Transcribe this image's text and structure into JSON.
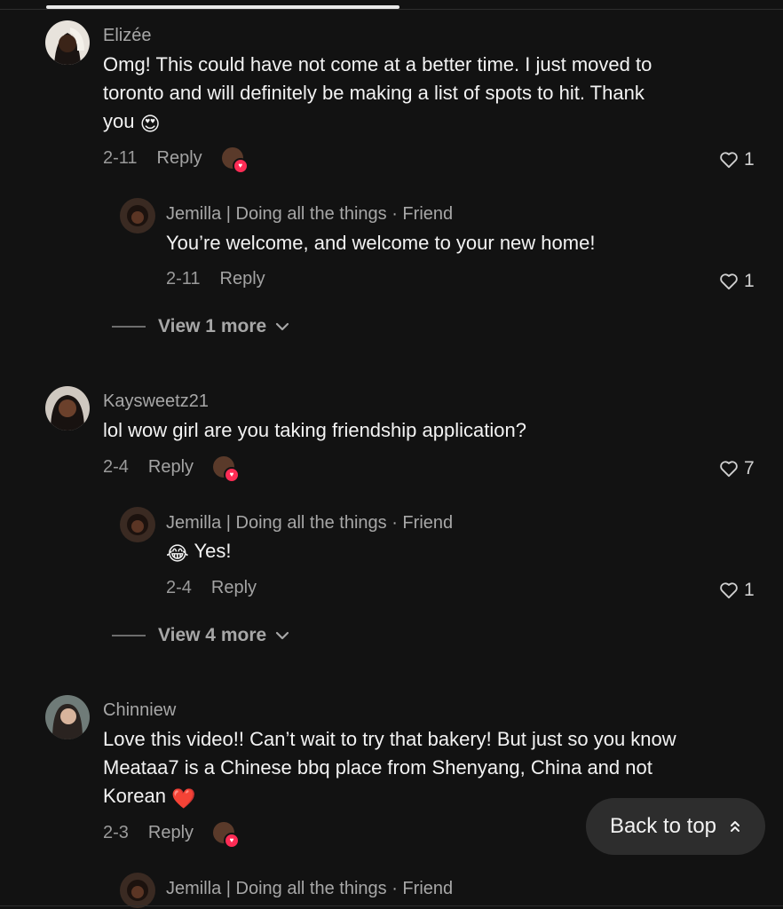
{
  "comments": [
    {
      "username": "Elizée",
      "text": "Omg! This could have not come at a better time. I just moved to toronto and will definitely be making a list of spots to hit. Thank you",
      "emoji": "😍",
      "date": "2-11",
      "reply_label": "Reply",
      "likes": "1",
      "replies": [
        {
          "username": "Jemilla | Doing all the things",
          "tag": "· Friend",
          "text": "You’re welcome, and welcome to your new home!",
          "date": "2-11",
          "reply_label": "Reply",
          "likes": "1"
        }
      ],
      "view_more": "View 1 more"
    },
    {
      "username": "Kaysweetz21",
      "text": "lol wow girl are you taking friendship application?",
      "date": "2-4",
      "reply_label": "Reply",
      "likes": "7",
      "replies": [
        {
          "username": "Jemilla | Doing all the things",
          "tag": "· Friend",
          "emoji": "😂",
          "text": "Yes!",
          "date": "2-4",
          "reply_label": "Reply",
          "likes": "1"
        }
      ],
      "view_more": "View 4 more"
    },
    {
      "username": "Chinniew",
      "text": "Love this video!! Can’t wait to try that bakery! But just so you know Meataa7 is a Chinese bbq place from Shenyang, China and not Korean",
      "emoji": "❤️",
      "date": "2-3",
      "reply_label": "Reply",
      "replies": [
        {
          "username": "Jemilla | Doing all the things",
          "tag": "· Friend"
        }
      ]
    }
  ],
  "back_to_top": "Back to top",
  "colors": {
    "background": "#121212",
    "accent": "#fe2c55"
  },
  "icons": {
    "like": "heart-outline-icon",
    "chevron": "chevron-down-icon",
    "back_to_top": "double-chevron-up-icon"
  }
}
